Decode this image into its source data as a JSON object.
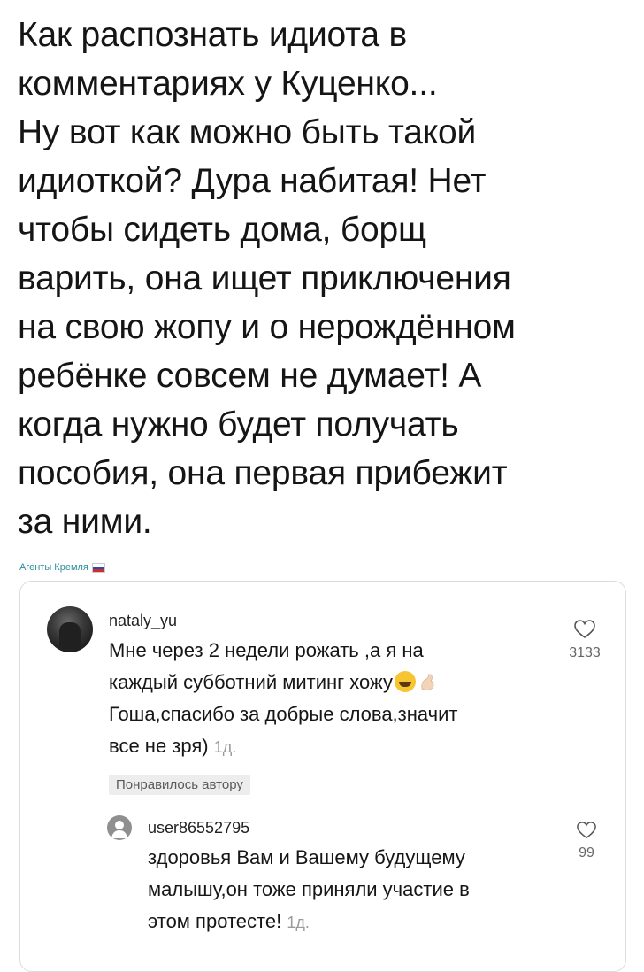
{
  "post": {
    "lines": [
      "Как распознать идиота в",
      "комментариях у Куценко...",
      "Ну вот как можно быть такой",
      "идиоткой? Дура набитая! Нет",
      "чтобы сидеть дома, борщ",
      "варить, она ищет приключения",
      "на свою жопу и о нерождённом",
      "ребёнке совсем не думает! А",
      "когда нужно будет получать",
      "пособия, она первая прибежит",
      "за ними."
    ],
    "source": "Агенты Кремля"
  },
  "comment": {
    "username": "nataly_yu",
    "lines": [
      "Мне через 2 недели рожать ,а я на",
      "каждый субботний митинг хожу",
      "Гоша,спасибо за добрые слова,значит",
      "все не зря)"
    ],
    "time": "1д.",
    "badge": "Понравилось автору",
    "likes": "3133",
    "icons": [
      "grinning-sweat-emoji",
      "flexed-biceps-emoji",
      "heart-outline-icon"
    ]
  },
  "reply": {
    "username": "user86552795",
    "lines": [
      "здоровья Вам и Вашему будущему",
      "малышу,он тоже приняли участие в",
      "этом протесте!"
    ],
    "time": "1д.",
    "likes": "99"
  },
  "colors": {
    "text": "#151515",
    "source_link": "#2f8ea0",
    "muted": "#9a9a9a",
    "badge_bg": "#ededed"
  }
}
